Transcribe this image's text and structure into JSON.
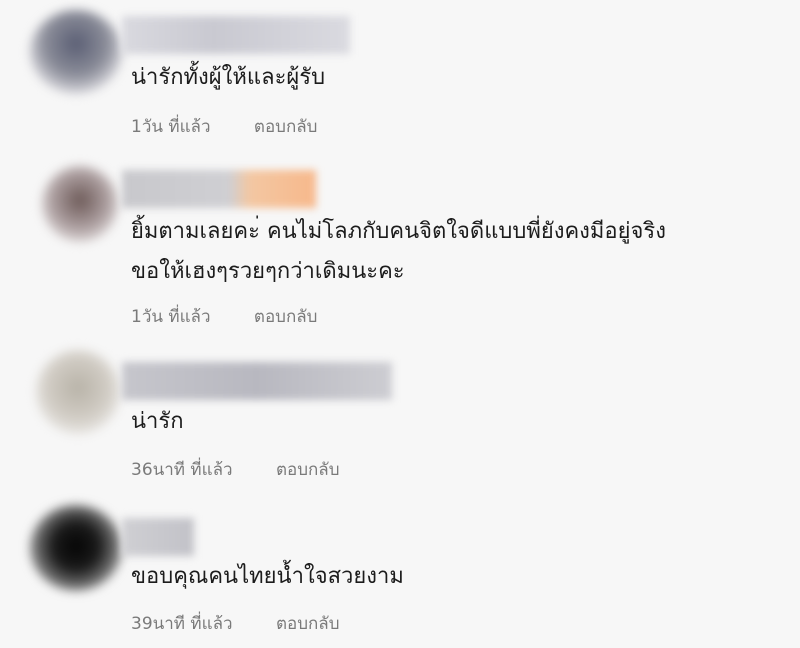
{
  "comments": [
    {
      "text_lines": [
        "น่ารักทั้งผู้ให้และผู้รับ"
      ],
      "time": "1วัน ที่แล้ว",
      "reply": "ตอบกลับ"
    },
    {
      "text_lines": [
        "ยิ้มตามเลยคะ่ คนไม่โลภกับคนจิตใจดีแบบพี่ยังคงมีอยู่จริง",
        "ขอให้เฮงๆรวยๆกว่าเดิมนะคะ"
      ],
      "time": "1วัน ที่แล้ว",
      "reply": "ตอบกลับ"
    },
    {
      "text_lines": [
        "น่ารัก"
      ],
      "time": "36นาที ที่แล้ว",
      "reply": "ตอบกลับ"
    },
    {
      "text_lines": [
        "ขอบคุณคนไทยน้ำใจสวยงาม"
      ],
      "time": "39นาที ที่แล้ว",
      "reply": "ตอบกลับ"
    }
  ]
}
